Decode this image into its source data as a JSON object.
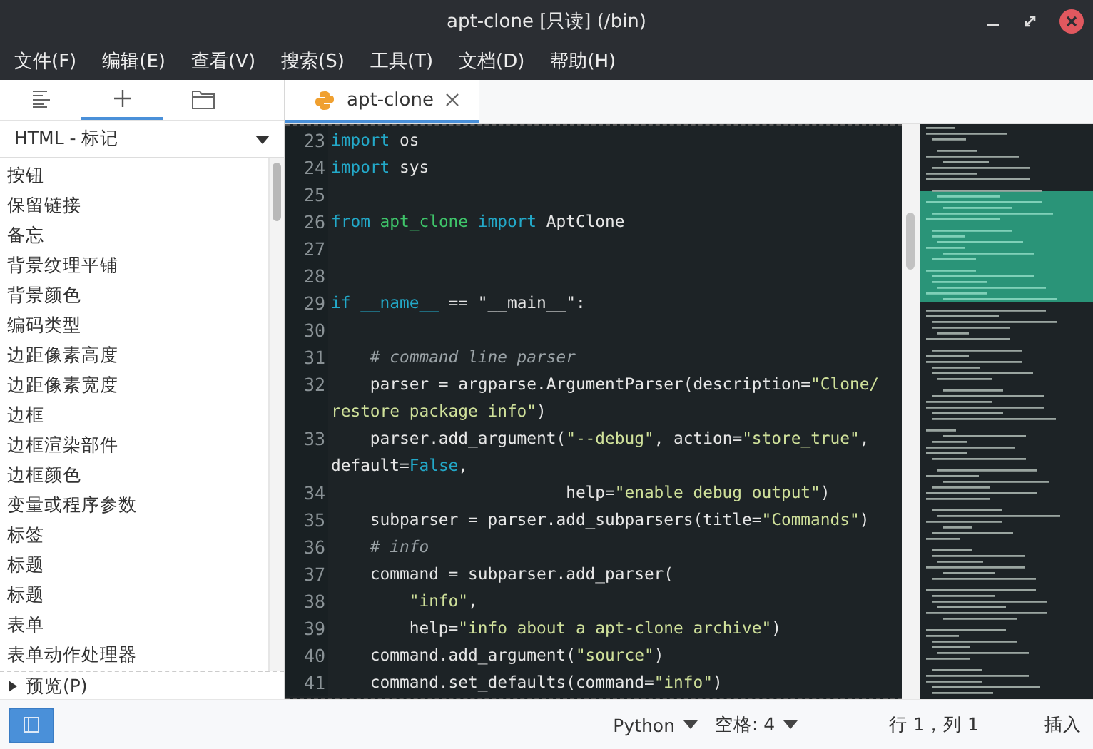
{
  "window": {
    "title": "apt-clone [只读] (/bin)"
  },
  "menu": [
    "文件(F)",
    "编辑(E)",
    "查看(V)",
    "搜索(S)",
    "工具(T)",
    "文档(D)",
    "帮助(H)"
  ],
  "sidebar": {
    "tabs": [
      {
        "kind": "outline",
        "selected": false
      },
      {
        "kind": "plus",
        "selected": true
      },
      {
        "kind": "folder",
        "selected": false
      }
    ],
    "dropdown": {
      "value": "HTML - 标记"
    },
    "items": [
      "按钮",
      "保留链接",
      "备忘",
      "背景纹理平铺",
      "背景颜色",
      "编码类型",
      "边距像素高度",
      "边距像素宽度",
      "边框",
      "边框渲染部件",
      "边框颜色",
      "变量或程序参数",
      "标签",
      "标题",
      "标题",
      "表单",
      "表单动作处理器"
    ],
    "preview": {
      "label": "预览(P)",
      "expanded": false
    }
  },
  "editor": {
    "tabs": [
      {
        "label": "apt-clone",
        "selected": true
      }
    ],
    "lines": [
      {
        "kind": "line",
        "number": "23",
        "tokens": [
          {
            "kind": "keyword",
            "text": "import"
          },
          {
            "kind": "plain",
            "text": " os"
          }
        ]
      },
      {
        "kind": "line",
        "number": "24",
        "tokens": [
          {
            "kind": "keyword",
            "text": "import"
          },
          {
            "kind": "plain",
            "text": " sys"
          }
        ]
      },
      {
        "kind": "line",
        "number": "25"
      },
      {
        "kind": "line",
        "number": "26",
        "tokens": [
          {
            "kind": "keyword",
            "text": "from"
          },
          {
            "kind": "module",
            "text": " apt_clone"
          },
          {
            "kind": "keyword",
            "text": " import"
          },
          {
            "kind": "plain",
            "text": " AptClone"
          }
        ]
      },
      {
        "kind": "line",
        "number": "27"
      },
      {
        "kind": "line",
        "number": "28"
      },
      {
        "kind": "line",
        "number": "29",
        "tokens": [
          {
            "kind": "keyword",
            "text": "if"
          },
          {
            "kind": "keyword",
            "text": " __name__"
          },
          {
            "kind": "plain",
            "text": " == \"__main__\":"
          }
        ]
      },
      {
        "kind": "line",
        "number": "30"
      },
      {
        "kind": "line",
        "number": "31",
        "tokens": [
          {
            "kind": "comment",
            "text": "    # command line parser"
          }
        ]
      },
      {
        "kind": "line",
        "number": "32",
        "tokens": [
          {
            "kind": "plain",
            "text": "    parser = argparse.ArgumentParser(description="
          },
          {
            "kind": "string",
            "text": "\"Clone/"
          }
        ]
      },
      {
        "kind": "wrap",
        "tokens": [
          {
            "kind": "string",
            "text": "restore package info\""
          },
          {
            "kind": "plain",
            "text": ")"
          }
        ]
      },
      {
        "kind": "line",
        "number": "33",
        "tokens": [
          {
            "kind": "plain",
            "text": "    parser.add_argument("
          },
          {
            "kind": "string",
            "text": "\"--debug\""
          },
          {
            "kind": "plain",
            "text": ", action="
          },
          {
            "kind": "string",
            "text": "\"store_true\""
          },
          {
            "kind": "plain",
            "text": ","
          }
        ]
      },
      {
        "kind": "wrap",
        "tokens": [
          {
            "kind": "plain",
            "text": "default="
          },
          {
            "kind": "keyword",
            "text": "False"
          },
          {
            "kind": "plain",
            "text": ","
          }
        ]
      },
      {
        "kind": "line",
        "number": "34",
        "tokens": [
          {
            "kind": "plain",
            "text": "                        help="
          },
          {
            "kind": "string",
            "text": "\"enable debug output\""
          },
          {
            "kind": "plain",
            "text": ")"
          }
        ]
      },
      {
        "kind": "line",
        "number": "35",
        "tokens": [
          {
            "kind": "plain",
            "text": "    subparser = parser.add_subparsers(title="
          },
          {
            "kind": "string",
            "text": "\"Commands\""
          },
          {
            "kind": "plain",
            "text": ")"
          }
        ]
      },
      {
        "kind": "line",
        "number": "36",
        "tokens": [
          {
            "kind": "comment",
            "text": "    # info"
          }
        ]
      },
      {
        "kind": "line",
        "number": "37",
        "tokens": [
          {
            "kind": "plain",
            "text": "    command = subparser.add_parser("
          }
        ]
      },
      {
        "kind": "line",
        "number": "38",
        "tokens": [
          {
            "kind": "string",
            "text": "        \"info\""
          },
          {
            "kind": "plain",
            "text": ","
          }
        ]
      },
      {
        "kind": "line",
        "number": "39",
        "tokens": [
          {
            "kind": "plain",
            "text": "        help="
          },
          {
            "kind": "string",
            "text": "\"info about a apt-clone archive\""
          },
          {
            "kind": "plain",
            "text": ")"
          }
        ]
      },
      {
        "kind": "line",
        "number": "40",
        "tokens": [
          {
            "kind": "plain",
            "text": "    command.add_argument("
          },
          {
            "kind": "string",
            "text": "\"source\""
          },
          {
            "kind": "plain",
            "text": ")"
          }
        ]
      },
      {
        "kind": "line",
        "number": "41",
        "tokens": [
          {
            "kind": "plain",
            "text": "    command.set_defaults(command="
          },
          {
            "kind": "string",
            "text": "\"info\""
          },
          {
            "kind": "plain",
            "text": ")"
          }
        ]
      }
    ]
  },
  "status_bar": {
    "language": "Python",
    "indent": "空格: 4",
    "position": "行 1，列 1",
    "mode": "插入"
  }
}
